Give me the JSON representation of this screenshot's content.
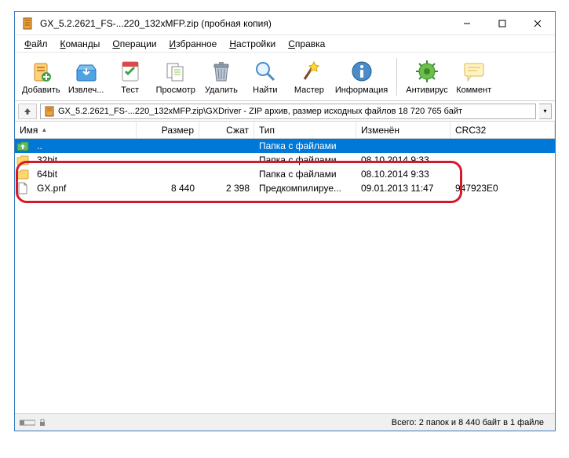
{
  "title": "GX_5.2.2621_FS-...220_132xMFP.zip (пробная копия)",
  "menu": [
    "Файл",
    "Команды",
    "Операции",
    "Избранное",
    "Настройки",
    "Справка"
  ],
  "toolbar": [
    {
      "label": "Добавить",
      "icon": "add"
    },
    {
      "label": "Извлеч...",
      "icon": "extract"
    },
    {
      "label": "Тест",
      "icon": "test"
    },
    {
      "label": "Просмотр",
      "icon": "view"
    },
    {
      "label": "Удалить",
      "icon": "delete"
    },
    {
      "label": "Найти",
      "icon": "find"
    },
    {
      "label": "Мастер",
      "icon": "wizard"
    },
    {
      "label": "Информация",
      "icon": "info"
    },
    {
      "label": "Антивирус",
      "icon": "antivirus"
    },
    {
      "label": "Коммент",
      "icon": "comment"
    }
  ],
  "address": "GX_5.2.2621_FS-...220_132xMFP.zip\\GXDriver - ZIP архив, размер исходных файлов 18 720 765 байт",
  "columns": {
    "name": "Имя",
    "size": "Размер",
    "packed": "Сжат",
    "type": "Тип",
    "modified": "Изменён",
    "crc": "CRC32"
  },
  "rows": [
    {
      "icon": "up",
      "name": "..",
      "size": "",
      "packed": "",
      "type": "Папка с файлами",
      "modified": "",
      "crc": "",
      "selected": true
    },
    {
      "icon": "folder",
      "name": "32bit",
      "size": "",
      "packed": "",
      "type": "Папка с файлами",
      "modified": "08.10.2014 9:33",
      "crc": ""
    },
    {
      "icon": "folder",
      "name": "64bit",
      "size": "",
      "packed": "",
      "type": "Папка с файлами",
      "modified": "08.10.2014 9:33",
      "crc": ""
    },
    {
      "icon": "file",
      "name": "GX.pnf",
      "size": "8 440",
      "packed": "2 398",
      "type": "Предкомпилируе...",
      "modified": "09.01.2013 11:47",
      "crc": "947923E0"
    }
  ],
  "status": {
    "left": "",
    "right": "Всего: 2 папок и 8 440 байт в 1 файле"
  }
}
